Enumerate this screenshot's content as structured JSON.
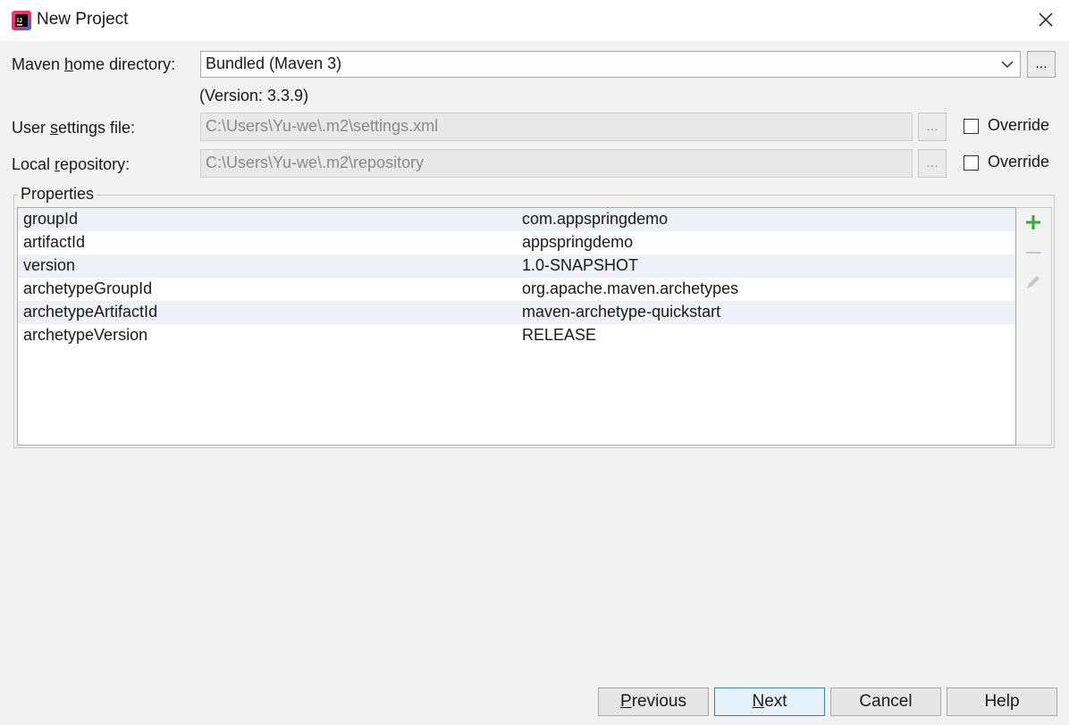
{
  "window": {
    "title": "New Project"
  },
  "form": {
    "maven_home": {
      "label_pre": "Maven ",
      "label_u": "h",
      "label_post": "ome directory:",
      "value": "Bundled (Maven 3)",
      "browse": "..."
    },
    "version_note": "(Version: 3.3.9)",
    "user_settings": {
      "label_pre": "User ",
      "label_u": "s",
      "label_post": "ettings file:",
      "value": "C:\\Users\\Yu-we\\.m2\\settings.xml",
      "browse": "...",
      "override": "Override"
    },
    "local_repo": {
      "label_pre": "Local ",
      "label_u": "r",
      "label_post": "epository:",
      "value": "C:\\Users\\Yu-we\\.m2\\repository",
      "browse": "...",
      "override": "Override"
    }
  },
  "properties": {
    "title": "Properties",
    "rows": [
      {
        "key": "groupId",
        "value": "com.appspringdemo"
      },
      {
        "key": "artifactId",
        "value": "appspringdemo"
      },
      {
        "key": "version",
        "value": "1.0-SNAPSHOT"
      },
      {
        "key": "archetypeGroupId",
        "value": "org.apache.maven.archetypes"
      },
      {
        "key": "archetypeArtifactId",
        "value": "maven-archetype-quickstart"
      },
      {
        "key": "archetypeVersion",
        "value": "RELEASE"
      }
    ],
    "tools": [
      "add-icon",
      "remove-icon",
      "edit-icon"
    ]
  },
  "buttons": {
    "previous": {
      "u": "P",
      "rest": "revious"
    },
    "next": {
      "u": "N",
      "rest": "ext"
    },
    "cancel": "Cancel",
    "help": "Help"
  },
  "colors": {
    "accent_green": "#3aa53a",
    "default_button_border": "#3c7fb1"
  }
}
